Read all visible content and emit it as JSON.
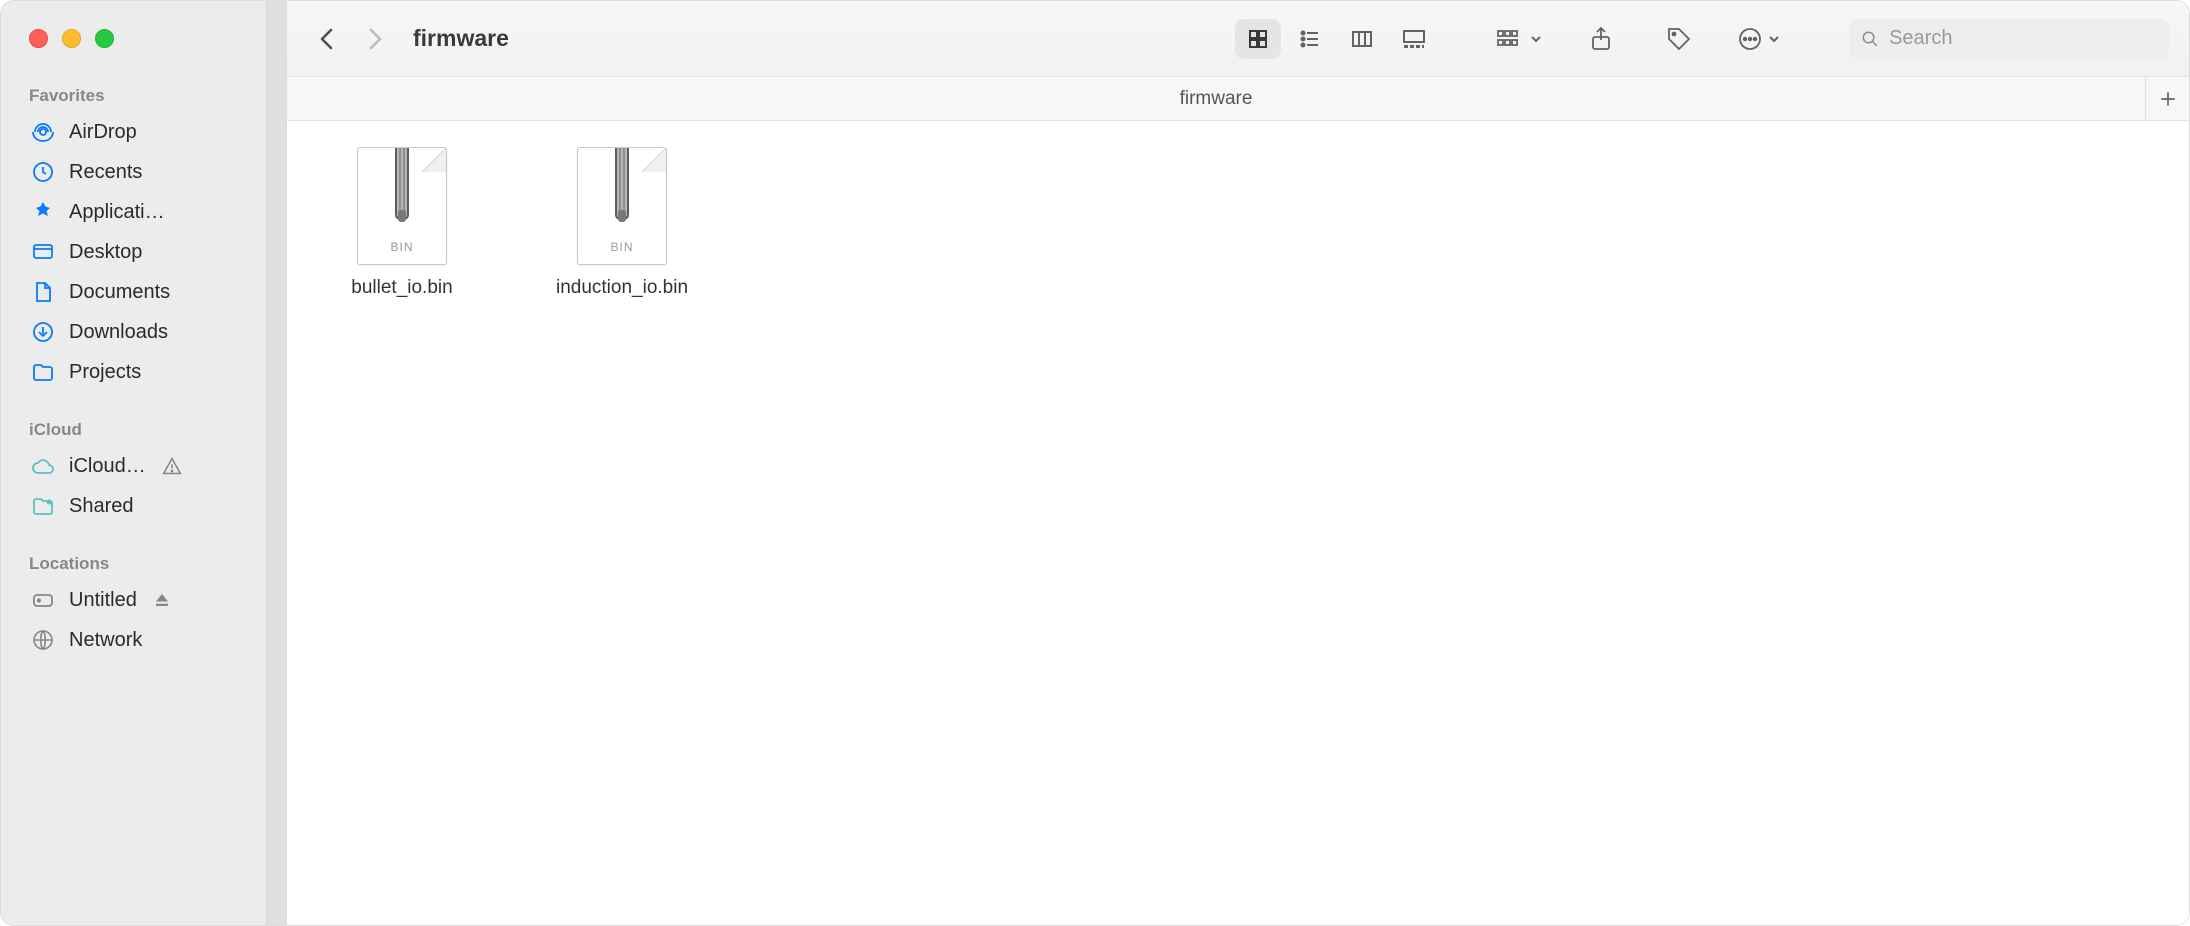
{
  "window": {
    "title": "firmware",
    "tab_label": "firmware",
    "search_placeholder": "Search"
  },
  "sidebar": {
    "sections": [
      {
        "header": "Favorites",
        "items": [
          {
            "label": "AirDrop",
            "icon": "airdrop-icon"
          },
          {
            "label": "Recents",
            "icon": "clock-icon"
          },
          {
            "label": "Applicati…",
            "icon": "applications-icon"
          },
          {
            "label": "Desktop",
            "icon": "desktop-icon"
          },
          {
            "label": "Documents",
            "icon": "document-icon"
          },
          {
            "label": "Downloads",
            "icon": "download-icon"
          },
          {
            "label": "Projects",
            "icon": "folder-icon"
          }
        ]
      },
      {
        "header": "iCloud",
        "items": [
          {
            "label": "iCloud…",
            "icon": "cloud-icon",
            "trail": "warning"
          },
          {
            "label": "Shared",
            "icon": "shared-folder-icon"
          }
        ]
      },
      {
        "header": "Locations",
        "items": [
          {
            "label": "Untitled",
            "icon": "disk-icon",
            "trail": "eject"
          },
          {
            "label": "Network",
            "icon": "network-icon"
          }
        ]
      }
    ]
  },
  "files": [
    {
      "name": "bullet_io.bin",
      "ext": "BIN"
    },
    {
      "name": "induction_io.bin",
      "ext": "BIN"
    }
  ]
}
